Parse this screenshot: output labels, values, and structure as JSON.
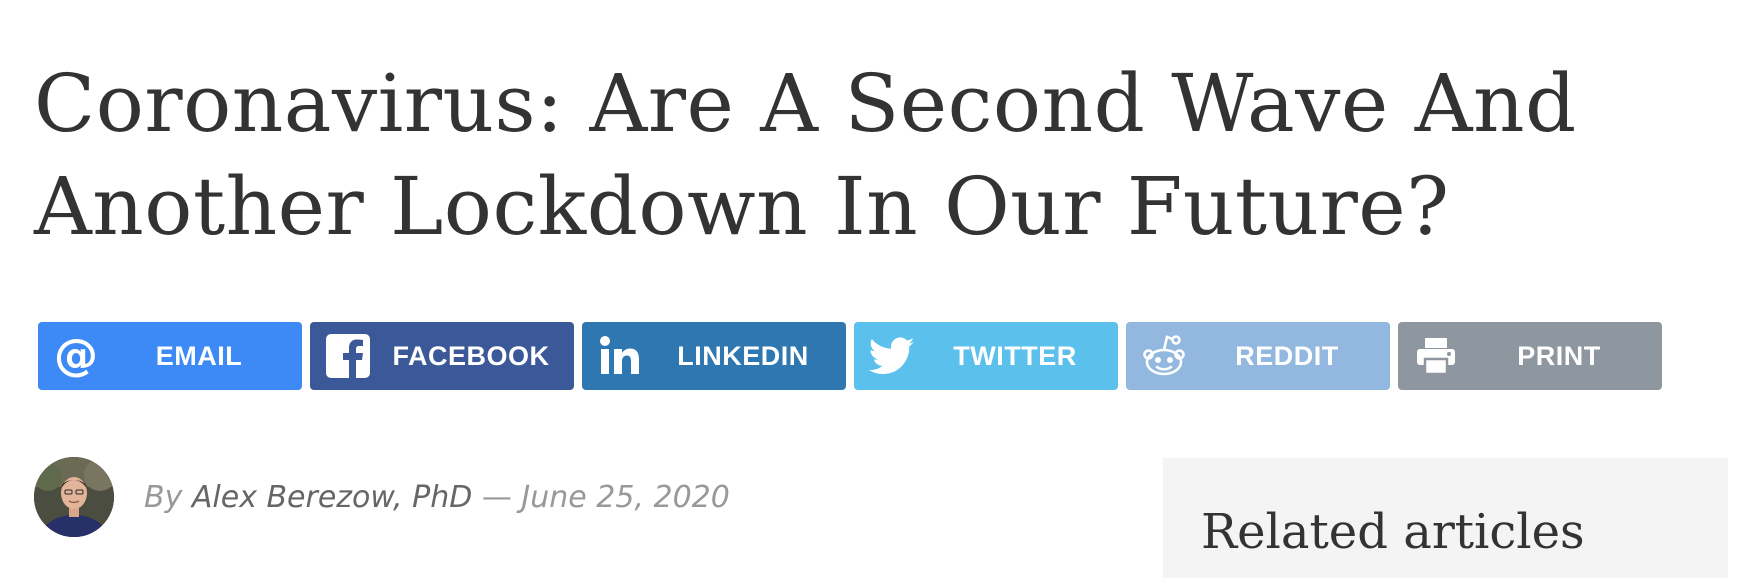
{
  "article": {
    "title": "Coronavirus: Are A Second Wave And Another Lockdown In Our Future?"
  },
  "share_buttons": [
    {
      "label": "EMAIL",
      "icon": "at-icon",
      "color": "#3d8af7"
    },
    {
      "label": "FACEBOOK",
      "icon": "facebook-icon",
      "color": "#3b5998"
    },
    {
      "label": "LINKEDIN",
      "icon": "linkedin-icon",
      "color": "#2f77b0"
    },
    {
      "label": "TWITTER",
      "icon": "twitter-icon",
      "color": "#5bc0eb"
    },
    {
      "label": "REDDIT",
      "icon": "reddit-icon",
      "color": "#93b8df"
    },
    {
      "label": "PRINT",
      "icon": "printer-icon",
      "color": "#8e969f"
    }
  ],
  "byline": {
    "prefix": "By ",
    "author": "Alex Berezow, PhD",
    "separator": " — ",
    "date": "June 25, 2020"
  },
  "sidebar": {
    "related_title": "Related articles"
  }
}
